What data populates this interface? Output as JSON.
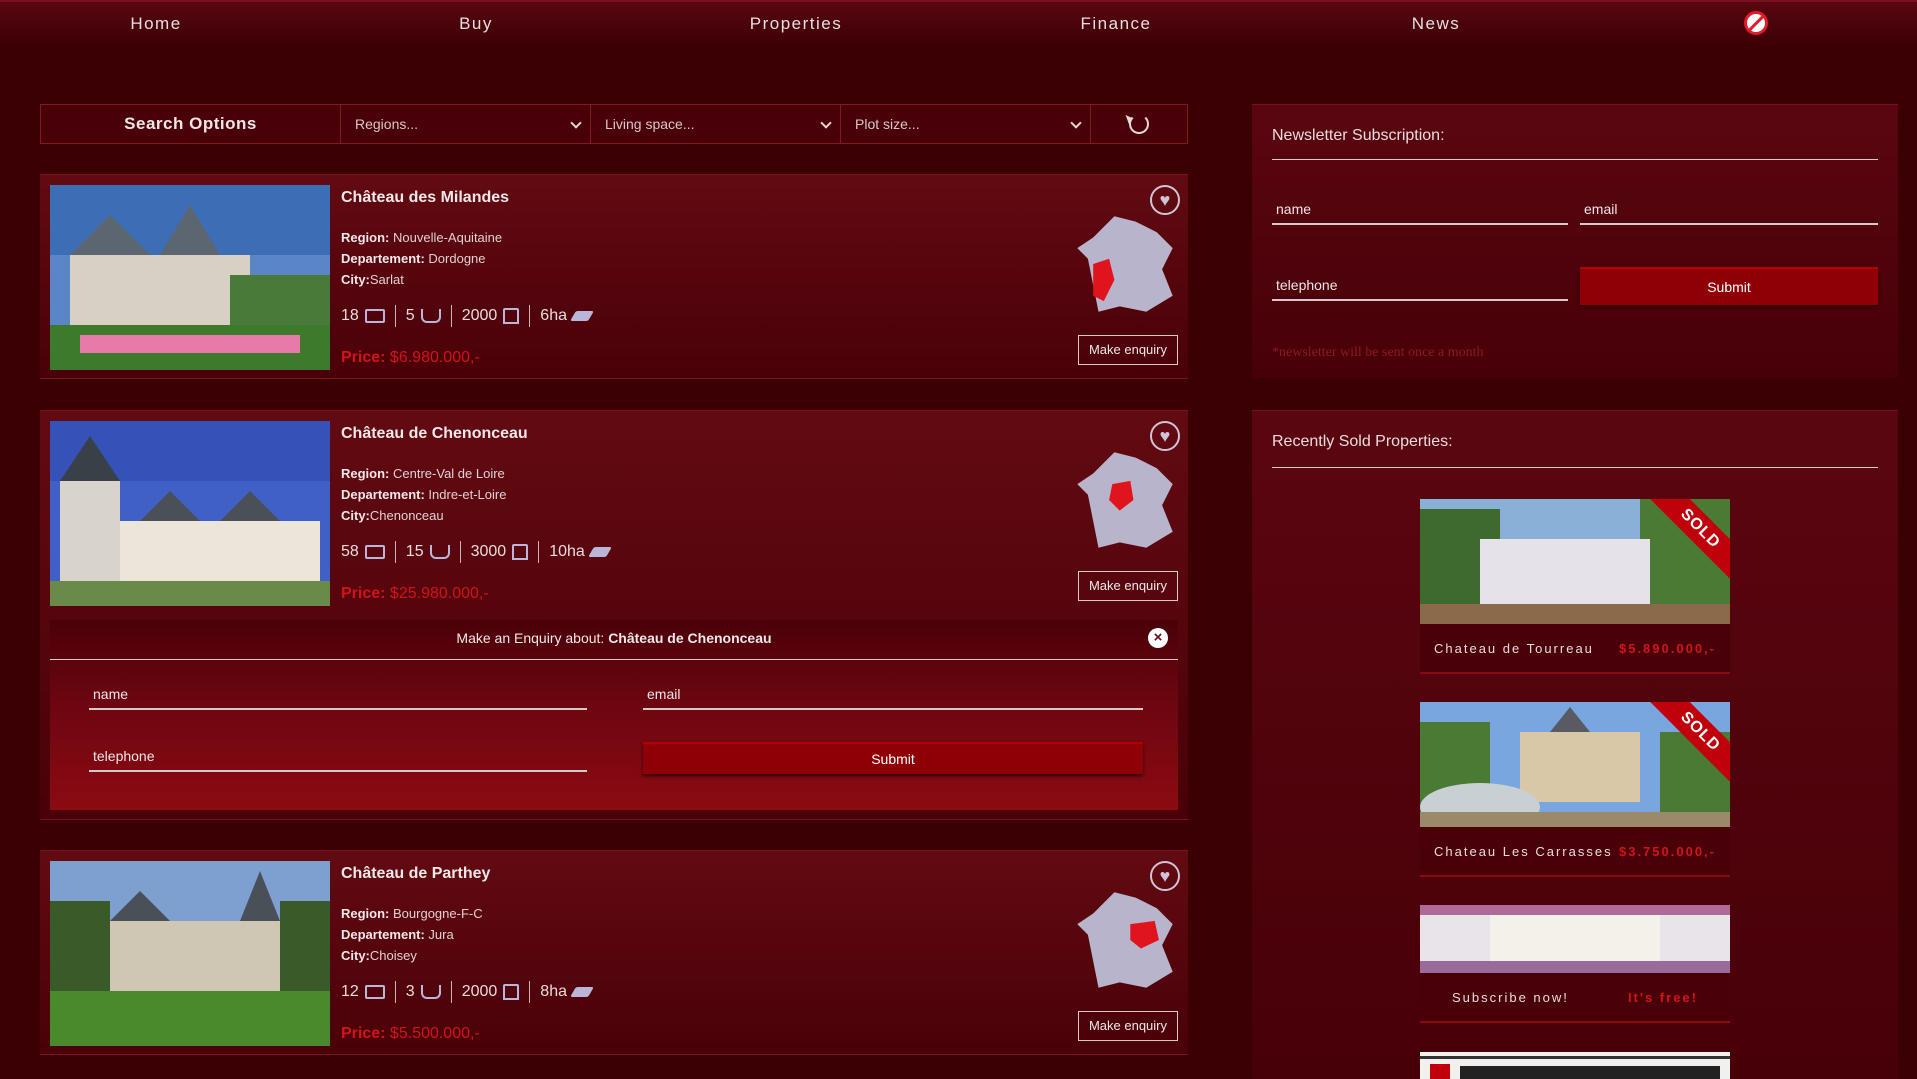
{
  "nav": {
    "items": [
      "Home",
      "Buy",
      "Properties",
      "Finance",
      "News"
    ]
  },
  "search": {
    "title": "Search Options",
    "regions": "Regions...",
    "living_space": "Living space...",
    "plot_size": "Plot size..."
  },
  "listings": [
    {
      "name": "Château des Milandes",
      "region_label": "Region:",
      "region": "Nouvelle-Aquitaine",
      "dept_label": "Departement:",
      "dept": "Dordogne",
      "city_label": "City:",
      "city": "Sarlat",
      "beds": "18",
      "baths": "5",
      "area": "2000",
      "plot": "6ha",
      "price_label": "Price:",
      "price": "$6.980.000,-",
      "enquiry_label": "Make enquiry"
    },
    {
      "name": "Château de Chenonceau",
      "region_label": "Region:",
      "region": "Centre-Val de Loire",
      "dept_label": "Departement:",
      "dept": "Indre-et-Loire",
      "city_label": "City:",
      "city": "Chenonceau",
      "beds": "58",
      "baths": "15",
      "area": "3000",
      "plot": "10ha",
      "price_label": "Price:",
      "price": "$25.980.000,-",
      "enquiry_label": "Make enquiry"
    },
    {
      "name": "Château de Parthey",
      "region_label": "Region:",
      "region": "Bourgogne-F-C",
      "dept_label": "Departement:",
      "dept": "Jura",
      "city_label": "City:",
      "city": "Choisey",
      "beds": "12",
      "baths": "3",
      "area": "2000",
      "plot": "8ha",
      "price_label": "Price:",
      "price": "$5.500.000,-",
      "enquiry_label": "Make enquiry"
    }
  ],
  "enquiry": {
    "heading_prefix": "Make an Enquiry about:",
    "heading_property": "Château de Chenonceau",
    "name_placeholder": "name",
    "email_placeholder": "email",
    "telephone_placeholder": "telephone",
    "submit_label": "Submit"
  },
  "newsletter": {
    "title": "Newsletter Subscription:",
    "name_placeholder": "name",
    "email_placeholder": "email",
    "telephone_placeholder": "telephone",
    "submit_label": "Submit",
    "note": "*newsletter will be sent once a month"
  },
  "recently_sold": {
    "title": "Recently Sold Properties:",
    "items": [
      {
        "name": "Chateau de Tourreau",
        "price": "$5.890.000,-",
        "badge": "SOLD"
      },
      {
        "name": "Chateau Les Carrasses",
        "price": "$3.750.000,-",
        "badge": "SOLD"
      }
    ],
    "promo": {
      "cta": "Subscribe now!",
      "free": "It's free!"
    }
  },
  "colors": {
    "background": "#3a0004",
    "accent_red": "#d1141c",
    "button_red": "#8f0006"
  }
}
